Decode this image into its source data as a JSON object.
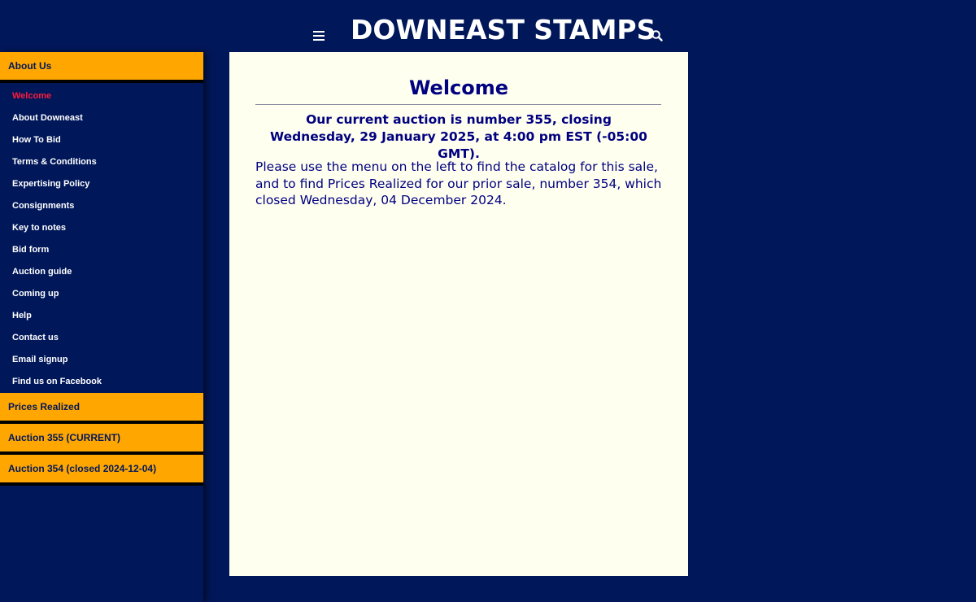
{
  "header": {
    "title": "DOWNEAST STAMPS",
    "menu_icon": "hamburger-menu-icon",
    "search_icon": "search-icon"
  },
  "sidebar": {
    "about_us": "About Us",
    "items": [
      {
        "label": "Welcome",
        "active": true
      },
      {
        "label": "About Downeast"
      },
      {
        "label": "How To Bid"
      },
      {
        "label": "Terms & Conditions"
      },
      {
        "label": "Expertising Policy"
      },
      {
        "label": "Consignments"
      },
      {
        "label": "Key to notes"
      },
      {
        "label": "Bid form"
      },
      {
        "label": "Auction guide"
      },
      {
        "label": "Coming up"
      },
      {
        "label": "Help"
      },
      {
        "label": "Contact us"
      },
      {
        "label": "Email signup"
      },
      {
        "label": "Find us on Facebook"
      }
    ],
    "prices_realized": "Prices Realized",
    "auction_current": "Auction 355 (CURRENT)",
    "auction_prior": "Auction 354 (closed 2024-12-04)"
  },
  "main": {
    "heading": "Welcome",
    "auction_line_1": "Our current auction is number 355, closing",
    "auction_line_2": "Wednesday, 29 January 2025, at 4:00 pm EST (-05:00 GMT).",
    "body": "Please use the menu on the left to find the catalog for this sale, and to find Prices Realized for our prior sale, number 354, which closed Wednesday, 04 December 2024."
  },
  "colors": {
    "background": "#00175a",
    "accent": "#ffa600",
    "content_bg": "#fffff0",
    "active_link": "#ff1a3c",
    "text_navy": "#000080"
  }
}
